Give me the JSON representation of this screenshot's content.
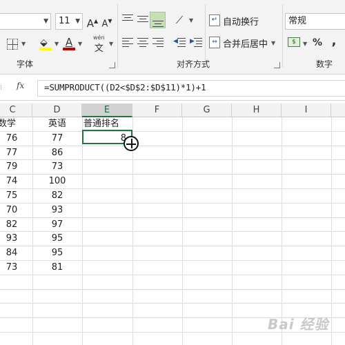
{
  "ribbon": {
    "font_name": "",
    "font_size": "11",
    "grow_font": "A",
    "shrink_font": "A",
    "wen_label": "wén",
    "wen_char": "文",
    "font_color_letter": "A",
    "wrap_text": "自动换行",
    "merge_center": "合并后居中",
    "number_format": "常规",
    "percent": "%",
    "comma": ",",
    "group_font": "字体",
    "group_align": "对齐方式",
    "group_number": "数字",
    "fill_color": "#ffff00",
    "font_color": "#c00000"
  },
  "formula_bar": {
    "fx": "fx",
    "formula": "=SUMPRODUCT((D2<$D$2:$D$11)*1)+1"
  },
  "columns": [
    "C",
    "D",
    "E",
    "F",
    "G",
    "H",
    "I"
  ],
  "selected_column": "E",
  "rows": [
    {
      "c": "数学",
      "d": "英语",
      "e": "普通排名"
    },
    {
      "c": "76",
      "d": "77",
      "e": "8"
    },
    {
      "c": "77",
      "d": "86",
      "e": ""
    },
    {
      "c": "79",
      "d": "73",
      "e": ""
    },
    {
      "c": "74",
      "d": "100",
      "e": ""
    },
    {
      "c": "75",
      "d": "82",
      "e": ""
    },
    {
      "c": "70",
      "d": "93",
      "e": ""
    },
    {
      "c": "82",
      "d": "97",
      "e": ""
    },
    {
      "c": "93",
      "d": "95",
      "e": ""
    },
    {
      "c": "84",
      "d": "95",
      "e": ""
    },
    {
      "c": "73",
      "d": "81",
      "e": ""
    }
  ],
  "watermark": "Bai 经验"
}
